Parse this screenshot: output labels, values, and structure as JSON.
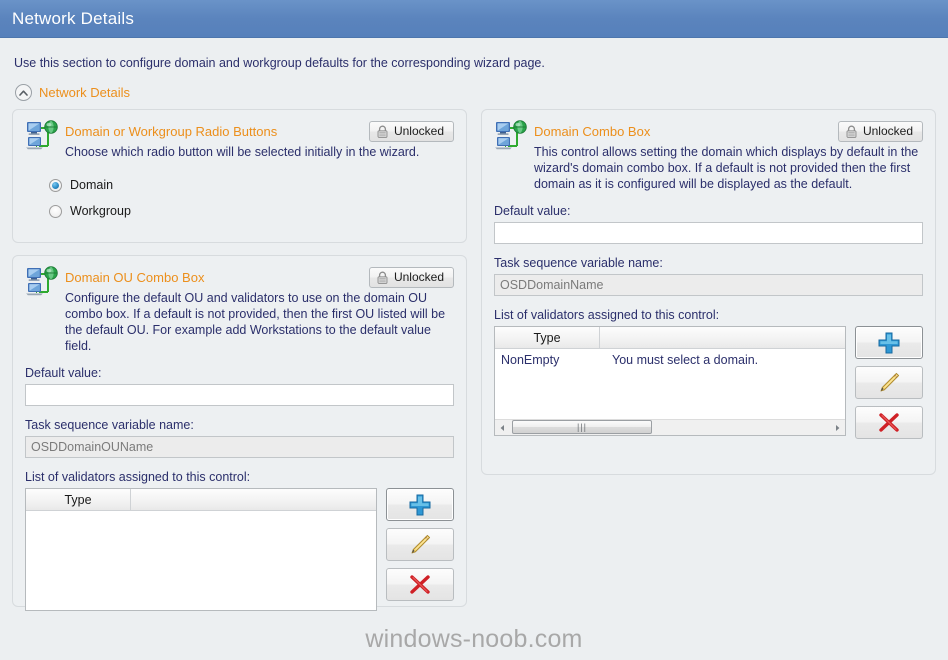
{
  "window": {
    "title": "Network Details"
  },
  "intro": {
    "text": "Use this section to configure domain and workgroup defaults for the corresponding wizard page."
  },
  "section": {
    "title": "Network Details",
    "chevron_icon": "chevron-up-icon",
    "expanded": true
  },
  "common": {
    "lock_label": "Unlocked",
    "lock_icon": "padlock-icon",
    "network_icon": "network-computers-icon",
    "default_value_label": "Default value:",
    "ts_variable_label": "Task sequence variable name:",
    "validators_label": "List of validators assigned to this control:",
    "grid_col_type": "Type",
    "grid_col_blank": "",
    "add_icon": "plus-icon",
    "edit_icon": "pencil-icon",
    "delete_icon": "red-x-icon",
    "scroll_left_icon": "triangle-left-icon",
    "scroll_right_icon": "triangle-right-icon",
    "scroll_grip": "|||"
  },
  "colors": {
    "titlebar": "#5b84bd",
    "accent_orange": "#ec8f1c",
    "text_navy": "#2b2f6b",
    "panel_bg": "#edf0f2",
    "page_bg": "#eceff1"
  },
  "panels": {
    "radio_buttons": {
      "title": "Domain or Workgroup Radio Buttons",
      "lock_label": "Unlocked",
      "description": "Choose which radio button will be selected initially in the wizard.",
      "options": [
        {
          "label": "Domain",
          "selected": true
        },
        {
          "label": "Workgroup",
          "selected": false
        }
      ]
    },
    "domain_ou_combo": {
      "title": "Domain OU Combo Box",
      "lock_label": "Unlocked",
      "description": "Configure the default OU and validators to use on the domain OU combo box. If a default is not provided, then the first OU listed will be the default OU. For example add Workstations to the default value field.",
      "default_value_label": "Default value:",
      "default_value": "",
      "default_value_placeholder": "",
      "ts_variable_label": "Task sequence variable name:",
      "ts_variable_value": "OSDDomainOUName",
      "validators_label": "List of validators assigned to this control:",
      "grid": {
        "columns": [
          "Type",
          ""
        ],
        "rows": []
      },
      "buttons": {
        "add": "plus-icon",
        "edit": "pencil-icon",
        "delete": "red-x-icon"
      }
    },
    "domain_combo": {
      "title": "Domain Combo Box",
      "lock_label": "Unlocked",
      "description": "This control allows setting the domain which displays by default in the wizard's domain combo box. If a default is not provided then the first domain as it is configured will be displayed as the default.",
      "default_value_label": "Default value:",
      "default_value": "",
      "default_value_placeholder": "",
      "ts_variable_label": "Task sequence variable name:",
      "ts_variable_value": "OSDDomainName",
      "validators_label": "List of validators assigned to this control:",
      "grid": {
        "columns": [
          "Type",
          ""
        ],
        "rows": [
          {
            "type": "NonEmpty",
            "message": "You must select a domain."
          }
        ]
      },
      "buttons": {
        "add": "plus-icon",
        "edit": "pencil-icon",
        "delete": "red-x-icon"
      }
    }
  },
  "watermark": {
    "text": "windows-noob.com"
  }
}
